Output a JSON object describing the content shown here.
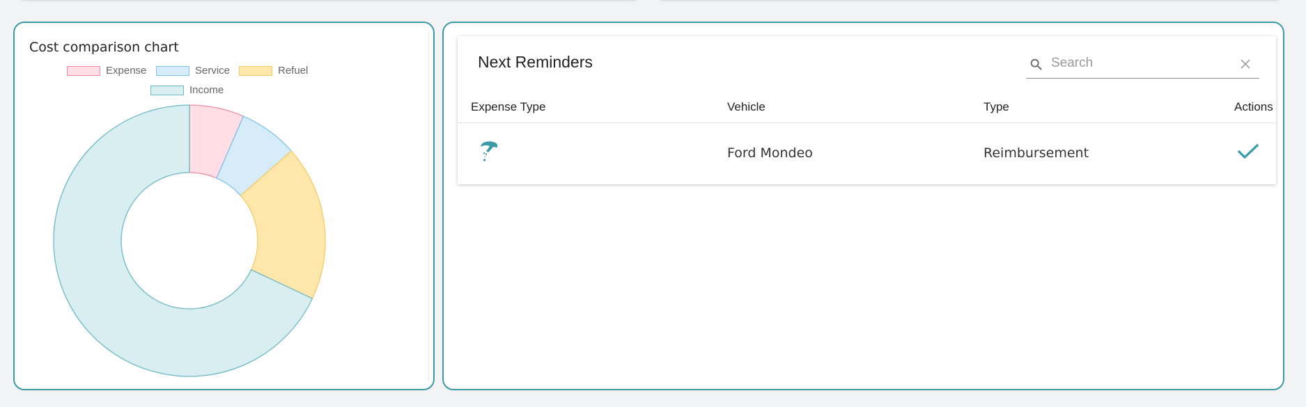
{
  "chart_card": {
    "title": "Cost comparison chart"
  },
  "chart_data": {
    "type": "pie",
    "title": "Cost comparison chart",
    "categories": [
      "Expense",
      "Service",
      "Refuel",
      "Income"
    ],
    "values": [
      6.5,
      7.0,
      18.5,
      68.0
    ],
    "colors": {
      "fill": [
        "#ffdfe5",
        "#d6ecf8",
        "#ffe6aa",
        "#d8eef0"
      ],
      "stroke": [
        "#f08ba1",
        "#7fc1ea",
        "#f5cc62",
        "#6db8c4"
      ]
    },
    "legend_position": "top"
  },
  "reminders": {
    "title": "Next Reminders",
    "search": {
      "placeholder": "Search",
      "value": ""
    },
    "columns": [
      "Expense Type",
      "Vehicle",
      "Type",
      "Actions"
    ],
    "rows": [
      {
        "expense_icon": "reminder-type-icon",
        "vehicle": "Ford Mondeo",
        "type": "Reimbursement",
        "action_icon": "check-icon"
      }
    ]
  },
  "colors": {
    "accent": "#3a9aa6",
    "background": "#f1f3f4"
  },
  "icons": {
    "search": "search-icon",
    "clear": "close-icon",
    "action": "check-icon"
  }
}
